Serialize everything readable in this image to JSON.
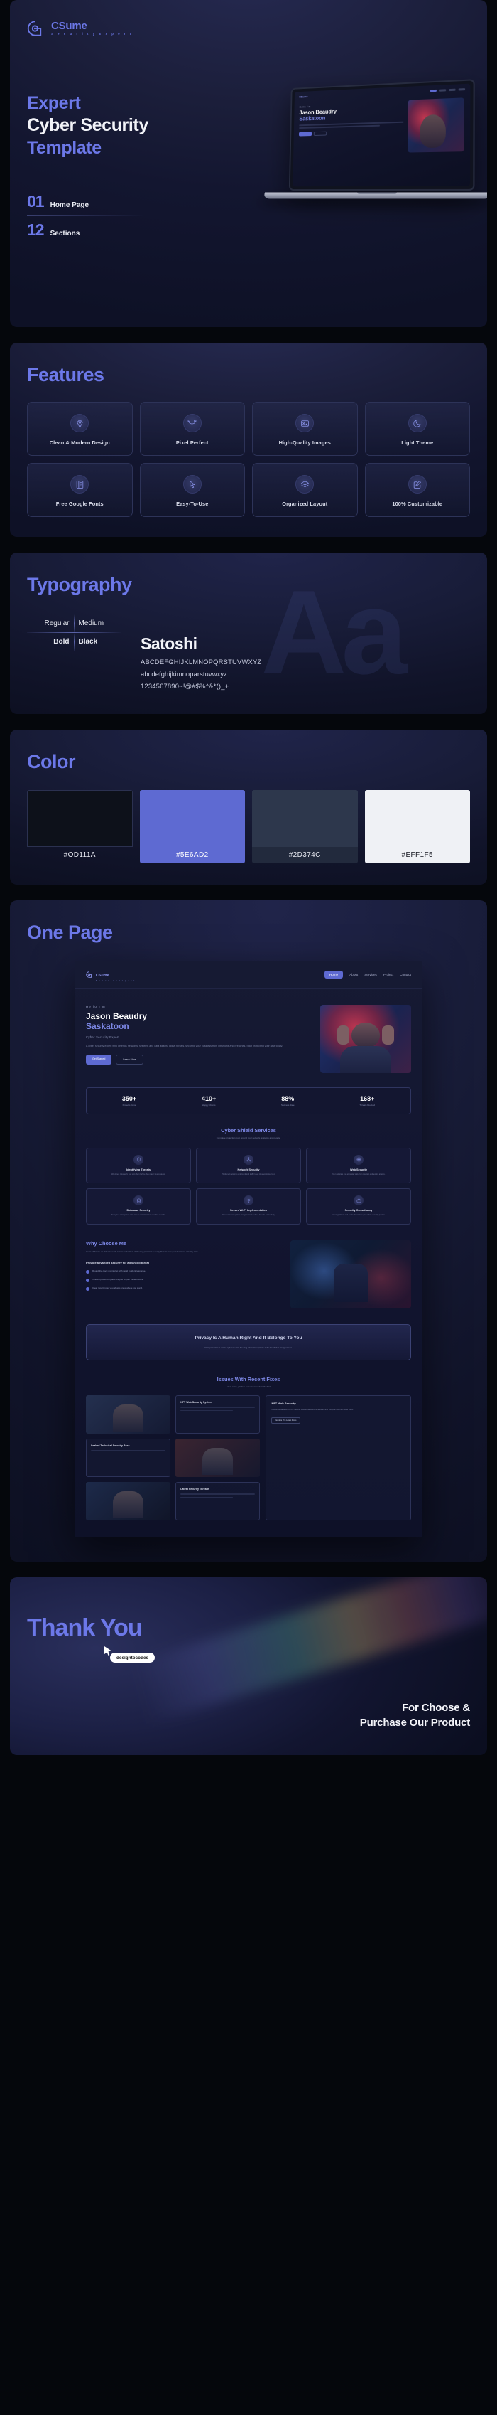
{
  "brand": {
    "logo_name": "CSume",
    "logo_sub": "S e c u r i t y   E x p e r t",
    "accent": "#5E6AD2",
    "accent_text": "#6C78E8"
  },
  "hero": {
    "line1": "Expert",
    "line2": "Cyber Security",
    "line3": "Template",
    "meta": [
      {
        "num": "01",
        "label": "Home Page"
      },
      {
        "num": "12",
        "label": "Sections"
      }
    ],
    "mock": {
      "hi": "Hello I'm",
      "name": "Jason Beaudry",
      "name_accent": "Saskatoon",
      "btn_primary": "Get Started",
      "btn_secondary": "Learn More"
    }
  },
  "features": {
    "title": "Features",
    "items": [
      {
        "label": "Clean & Modern Design",
        "icon": "pen-tool-icon"
      },
      {
        "label": "Pixel Perfect",
        "icon": "vector-nodes-icon"
      },
      {
        "label": "High-Quality Images",
        "icon": "image-icon"
      },
      {
        "label": "Light Theme",
        "icon": "moon-icon"
      },
      {
        "label": "Free Google Fonts",
        "icon": "text-column-icon"
      },
      {
        "label": "Easy-To-Use",
        "icon": "cursor-click-icon"
      },
      {
        "label": "Organized Layout",
        "icon": "layers-icon"
      },
      {
        "label": "100% Customizable",
        "icon": "edit-square-icon"
      }
    ]
  },
  "typography": {
    "title": "Typography",
    "ghost": "Aa",
    "weights": [
      [
        "Regular",
        "Medium"
      ],
      [
        "Bold",
        "Black"
      ]
    ],
    "font_name": "Satoshi",
    "uppercase": "ABCDEFGHIJKLMNOPQRSTUVWXYZ",
    "lowercase": "abcdefghijkimnoparstuvwxyz",
    "numerals": "1234567890~!@#$%^&*()_+"
  },
  "color": {
    "title": "Color",
    "swatches": [
      {
        "hex": "#0D111A",
        "label": "#OD111A",
        "label_color": "#E8EAF2",
        "label_bg": "transparent"
      },
      {
        "hex": "#5E6AD2",
        "label": "#5E6AD2",
        "label_color": "#FFFFFF",
        "label_bg": "#5E6AD2"
      },
      {
        "hex": "#2D374C",
        "label": "#2D374C",
        "label_color": "#E8EAF2",
        "label_bg": "#222a3d"
      },
      {
        "hex": "#EFF1F5",
        "label": "#EFF1F5",
        "label_color": "#14161F",
        "label_bg": "#EFF1F5"
      }
    ]
  },
  "onepage": {
    "title": "One Page",
    "nav": [
      "Home",
      "About",
      "Services",
      "Project",
      "Contact"
    ],
    "hero": {
      "hi": "Hello I'm",
      "name": "Jason Beaudry",
      "name_accent": "Saskatoon",
      "role": "Cyber Security Expert",
      "desc": "A cyber security expert who defends networks, systems and data against digital threats, securing your business from intrusions and breaches. Start protecting your data today.",
      "btn_primary": "Get Started",
      "btn_secondary": "Learn More"
    },
    "stats": [
      {
        "value": "350+",
        "label": "Projects Done"
      },
      {
        "value": "410+",
        "label": "Happy Clients"
      },
      {
        "value": "88%",
        "label": "Success Rate"
      },
      {
        "value": "168+",
        "label": "Threats Blocked"
      }
    ],
    "services": {
      "title": "Cyber Shield Services",
      "desc": "Complete protection built around your network, systems and people.",
      "cards": [
        {
          "title": "Identifying Threats",
          "desc": "We detect risks early and stop them before they reach your systems.",
          "icon": "shield-search-icon"
        },
        {
          "title": "Network Security",
          "desc": "Hardened networks and monitored traffic keep intruders locked out.",
          "icon": "network-icon"
        },
        {
          "title": "Web Security",
          "desc": "Your websites and apps stay safe from injection and exploit attacks.",
          "icon": "globe-icon"
        },
        {
          "title": "Database Security",
          "desc": "Encrypted storage and strict access control protect sensitive records.",
          "icon": "database-icon"
        },
        {
          "title": "Secure Wi-Fi Implementation",
          "desc": "Wireless access points configured and audited for safe connectivity.",
          "icon": "wifi-icon"
        },
        {
          "title": "Security Consultancy",
          "desc": "Expert guidance and audits that mature your whole security posture.",
          "icon": "briefcase-icon"
        }
      ]
    },
    "why": {
      "title": "Why Choose Me",
      "desc": "Years of hands-on defence work across industries, delivering practical security that fits how your business actually runs.",
      "subtitle": "Provide advanced security for advanced threat",
      "bullets": [
        "Round the clock monitoring with rapid incident response.",
        "Tailored protection plans shaped to your infrastructure.",
        "Clear reporting so you always know where you stand."
      ]
    },
    "quote": {
      "title": "Privacy Is A Human Right And It Belongs To You",
      "desc": "Data protection is not an optional extra. Keeping information private is the foundation of digital trust."
    },
    "blog": {
      "title": "Issues With Recent Fixes",
      "desc": "Latest notes, patches and advisories from the field.",
      "posts": [
        {
          "title": "NFT Web Security System"
        },
        {
          "title": "Leaked Technical Security Base"
        },
        {
          "title": "Latest Security Threads"
        }
      ],
      "side": {
        "title": "NFT Web Security",
        "meta": "A short breakdown of the newest marketplace vulnerabilities and the patches that close them.",
        "tag": "Explore The Latest Posts"
      }
    }
  },
  "thanks": {
    "title": "Thank You",
    "badge": "designtocodes",
    "foot_line1": "For Choose &",
    "foot_line2": "Purchase Our Product"
  }
}
